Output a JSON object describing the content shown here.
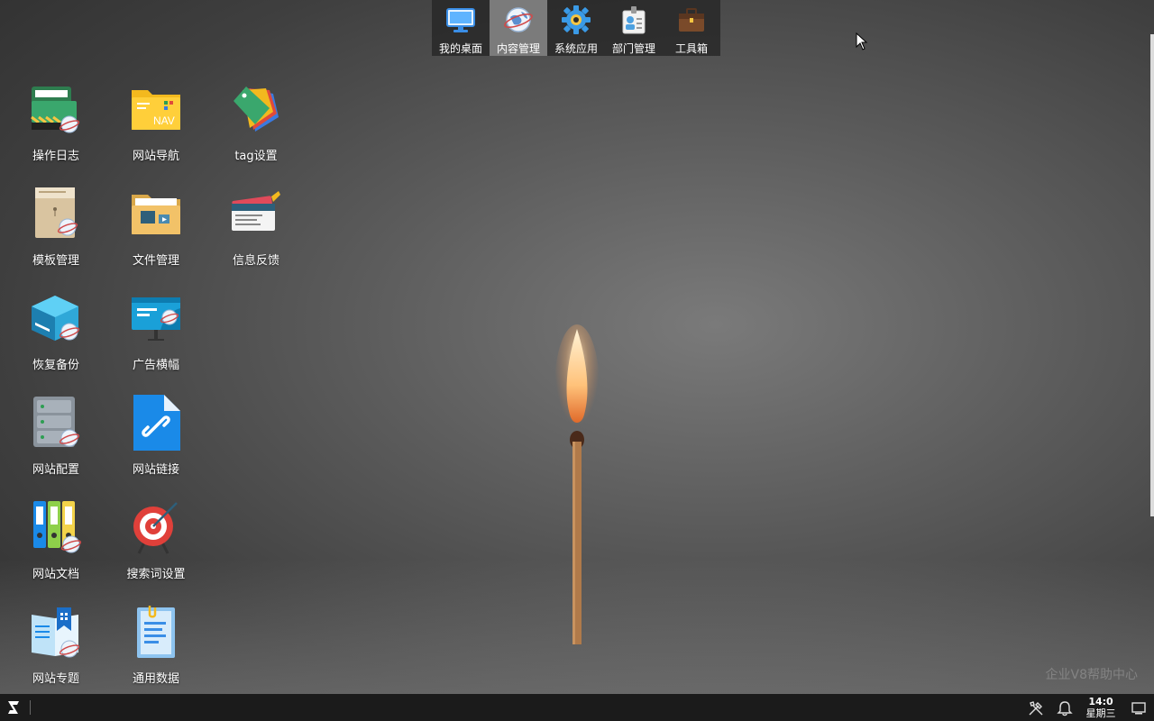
{
  "topnav": {
    "items": [
      {
        "label": "我的桌面",
        "icon": "monitor-icon",
        "active": false
      },
      {
        "label": "内容管理",
        "icon": "globe-icon",
        "active": true
      },
      {
        "label": "系统应用",
        "icon": "gear-icon",
        "active": false
      },
      {
        "label": "部门管理",
        "icon": "id-badge-icon",
        "active": false
      },
      {
        "label": "工具箱",
        "icon": "toolbox-icon",
        "active": false
      }
    ]
  },
  "desktop": {
    "icons": [
      {
        "label": "操作日志",
        "icon": "operation-log-icon"
      },
      {
        "label": "网站导航",
        "icon": "nav-folder-icon"
      },
      {
        "label": "tag设置",
        "icon": "tag-icon"
      },
      {
        "label": "模板管理",
        "icon": "template-icon"
      },
      {
        "label": "文件管理",
        "icon": "file-folder-icon"
      },
      {
        "label": "信息反馈",
        "icon": "feedback-icon"
      },
      {
        "label": "恢复备份",
        "icon": "backup-icon"
      },
      {
        "label": "广告横幅",
        "icon": "banner-icon"
      },
      {
        "label": "网站配置",
        "icon": "server-config-icon"
      },
      {
        "label": "网站链接",
        "icon": "link-document-icon"
      },
      {
        "label": "网站文档",
        "icon": "binders-icon"
      },
      {
        "label": "搜索词设置",
        "icon": "target-icon"
      },
      {
        "label": "网站专题",
        "icon": "topic-book-icon"
      },
      {
        "label": "通用数据",
        "icon": "clipboard-data-icon"
      }
    ]
  },
  "watermark": "企业V8帮助中心",
  "taskbar": {
    "time": "14:0",
    "weekday": "星期三"
  }
}
